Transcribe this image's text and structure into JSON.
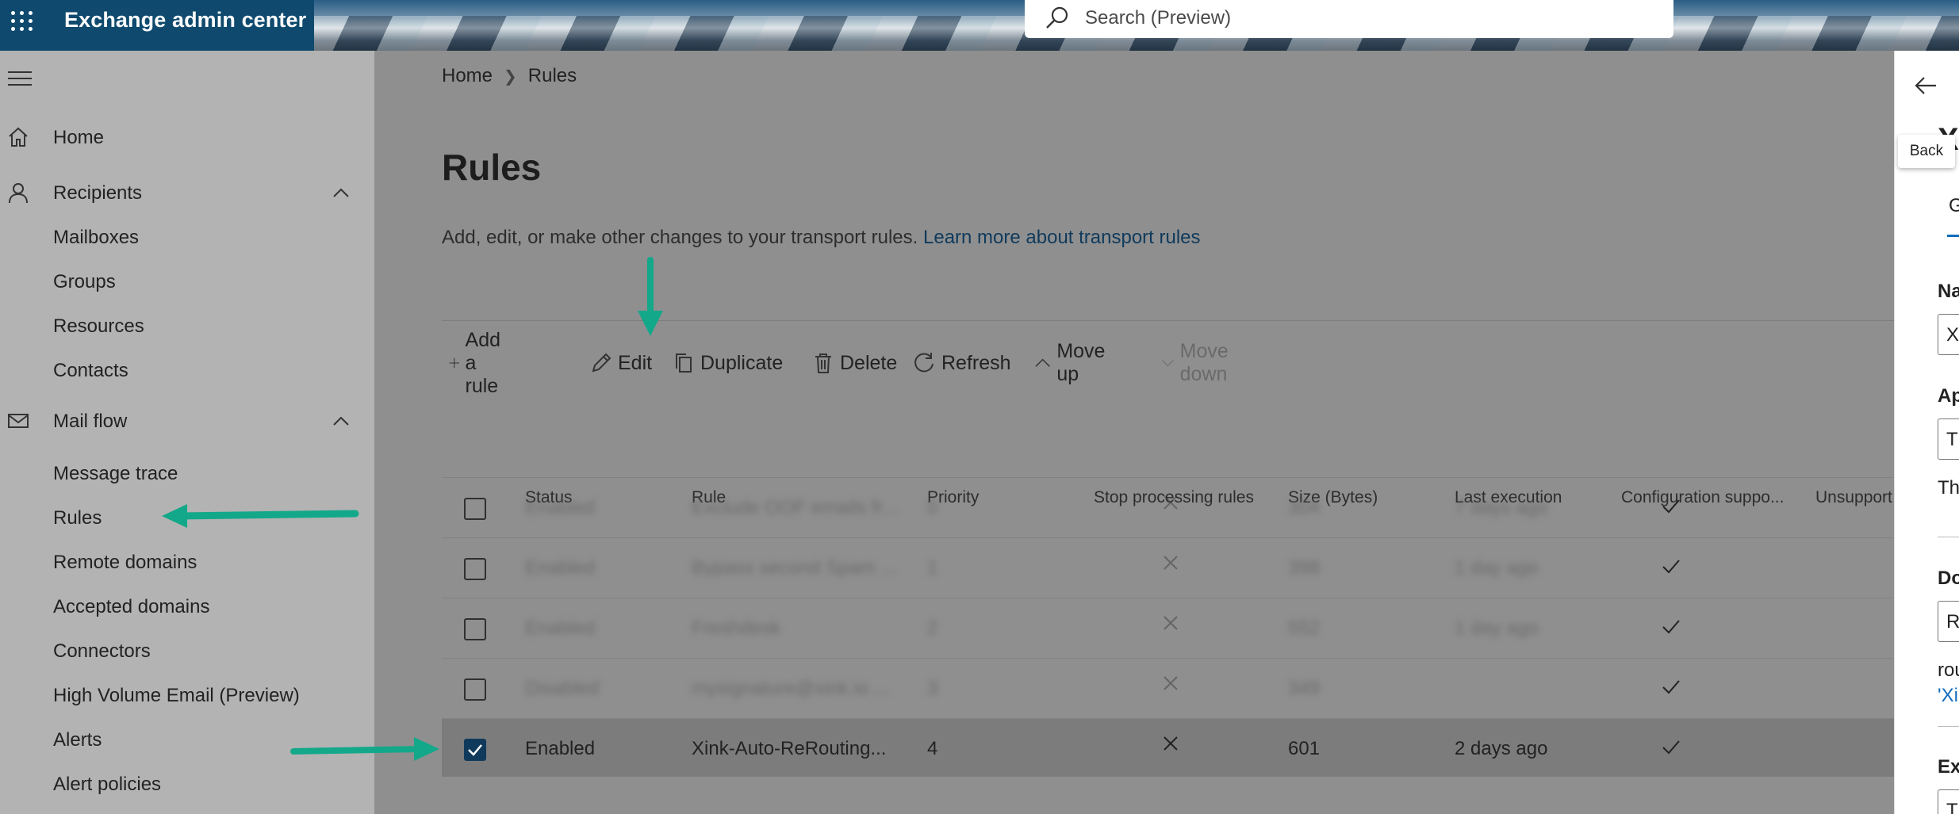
{
  "app": {
    "title": "Exchange admin center"
  },
  "search": {
    "placeholder": "Search (Preview)"
  },
  "sidebar": {
    "items": [
      {
        "label": "Home",
        "icon": "home-icon"
      },
      {
        "label": "Recipients",
        "icon": "person-icon"
      },
      {
        "label": "Mail flow",
        "icon": "mail-icon"
      }
    ],
    "recipients_sub": [
      "Mailboxes",
      "Groups",
      "Resources",
      "Contacts"
    ],
    "mailflow_sub": [
      "Message trace",
      "Rules",
      "Remote domains",
      "Accepted domains",
      "Connectors",
      "High Volume Email (Preview)",
      "Alerts",
      "Alert policies"
    ]
  },
  "breadcrumb": {
    "home": "Home",
    "current": "Rules"
  },
  "page": {
    "title": "Rules",
    "description": "Add, edit, or make other changes to your transport rules.",
    "link": "Learn more about transport rules"
  },
  "toolbar": {
    "add": "Add a rule",
    "edit": "Edit",
    "duplicate": "Duplicate",
    "delete": "Delete",
    "refresh": "Refresh",
    "move_up": "Move up",
    "move_down": "Move down"
  },
  "table": {
    "headers": [
      "Status",
      "Rule",
      "Priority",
      "Stop processing rules",
      "Size (Bytes)",
      "Last execution",
      "Configuration suppo...",
      "Unsupport"
    ],
    "rows": [
      {
        "status": "Enabled",
        "rule": "Exclude OOF emails fr...",
        "priority": "0",
        "size": "304",
        "last": "7 days ago",
        "selected": false,
        "blurred": true
      },
      {
        "status": "Enabled",
        "rule": "Bypass second Spam ...",
        "priority": "1",
        "size": "398",
        "last": "1 day ago",
        "selected": false,
        "blurred": true
      },
      {
        "status": "Enabled",
        "rule": "Freshdesk",
        "priority": "2",
        "size": "552",
        "last": "1 day ago",
        "selected": false,
        "blurred": true
      },
      {
        "status": "Disabled",
        "rule": "mysignature@xink.io ...",
        "priority": "3",
        "size": "349",
        "last": "",
        "selected": false,
        "blurred": true
      },
      {
        "status": "Enabled",
        "rule": "Xink-Auto-ReRouting...",
        "priority": "4",
        "size": "601",
        "last": "2 days ago",
        "selected": true,
        "blurred": false
      }
    ]
  },
  "panel": {
    "tooltip": "Back",
    "heading": "X",
    "tab": "G",
    "labels": [
      "Na",
      "Ap",
      "Do",
      "Exc"
    ],
    "boxes": [
      "X",
      "T",
      "R",
      "T"
    ],
    "texts": [
      "Th",
      "rou",
      "'Xi"
    ]
  },
  "colors": {
    "arrow": "#13a88a",
    "link": "#0f3a5c",
    "checkbox": "#0f3a5c"
  }
}
